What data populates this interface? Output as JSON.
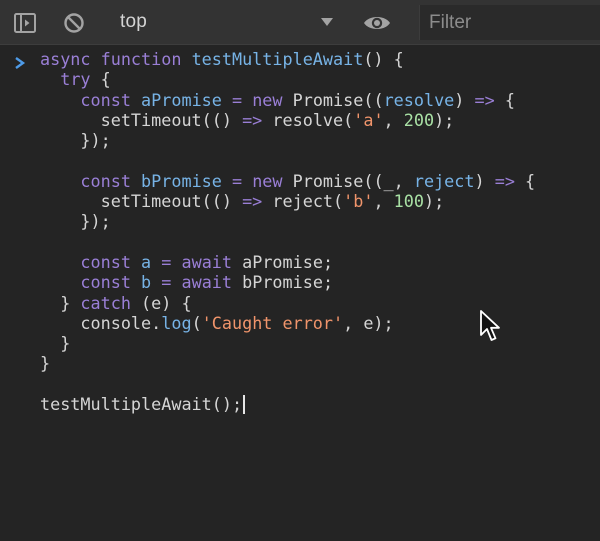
{
  "toolbar": {
    "sidebar_icon": "sidebar-toggle-icon",
    "clear_icon": "clear-console-icon",
    "context_value": "top",
    "caret_icon": "caret-down-icon",
    "eye_icon": "live-expression-eye-icon",
    "filter_placeholder": "Filter",
    "filter_value": ""
  },
  "console": {
    "prompt_icon": "prompt-chevron-icon",
    "lines": [
      [
        [
          "kw",
          "async "
        ],
        [
          "kw",
          "function "
        ],
        [
          "fn",
          "testMultipleAwait"
        ],
        [
          "pl",
          "() {"
        ]
      ],
      [
        [
          "pl",
          "  "
        ],
        [
          "kw",
          "try"
        ],
        [
          "pl",
          " {"
        ]
      ],
      [
        [
          "pl",
          "    "
        ],
        [
          "kw",
          "const "
        ],
        [
          "var",
          "aPromise"
        ],
        [
          "pl",
          " "
        ],
        [
          "kw",
          "="
        ],
        [
          "pl",
          " "
        ],
        [
          "kw",
          "new"
        ],
        [
          "pl",
          " Promise(("
        ],
        [
          "par",
          "resolve"
        ],
        [
          "pl",
          ") "
        ],
        [
          "kw",
          "=>"
        ],
        [
          "pl",
          " {"
        ]
      ],
      [
        [
          "pl",
          "      setTimeout(() "
        ],
        [
          "kw",
          "=>"
        ],
        [
          "pl",
          " resolve("
        ],
        [
          "str",
          "'a'"
        ],
        [
          "pl",
          ", "
        ],
        [
          "num",
          "200"
        ],
        [
          "pl",
          ");"
        ]
      ],
      [
        [
          "pl",
          "    });"
        ]
      ],
      [
        [
          "pl",
          ""
        ]
      ],
      [
        [
          "pl",
          "    "
        ],
        [
          "kw",
          "const "
        ],
        [
          "var",
          "bPromise"
        ],
        [
          "pl",
          " "
        ],
        [
          "kw",
          "="
        ],
        [
          "pl",
          " "
        ],
        [
          "kw",
          "new"
        ],
        [
          "pl",
          " Promise((_"
        ],
        [
          "pl",
          ", "
        ],
        [
          "par",
          "reject"
        ],
        [
          "pl",
          ") "
        ],
        [
          "kw",
          "=>"
        ],
        [
          "pl",
          " {"
        ]
      ],
      [
        [
          "pl",
          "      setTimeout(() "
        ],
        [
          "kw",
          "=>"
        ],
        [
          "pl",
          " reject("
        ],
        [
          "str",
          "'b'"
        ],
        [
          "pl",
          ", "
        ],
        [
          "num",
          "100"
        ],
        [
          "pl",
          ");"
        ]
      ],
      [
        [
          "pl",
          "    });"
        ]
      ],
      [
        [
          "pl",
          ""
        ]
      ],
      [
        [
          "pl",
          "    "
        ],
        [
          "kw",
          "const "
        ],
        [
          "var",
          "a"
        ],
        [
          "pl",
          " "
        ],
        [
          "kw",
          "="
        ],
        [
          "pl",
          " "
        ],
        [
          "kw",
          "await"
        ],
        [
          "pl",
          " aPromise;"
        ]
      ],
      [
        [
          "pl",
          "    "
        ],
        [
          "kw",
          "const "
        ],
        [
          "var",
          "b"
        ],
        [
          "pl",
          " "
        ],
        [
          "kw",
          "="
        ],
        [
          "pl",
          " "
        ],
        [
          "kw",
          "await"
        ],
        [
          "pl",
          " bPromise;"
        ]
      ],
      [
        [
          "pl",
          "  } "
        ],
        [
          "kw",
          "catch"
        ],
        [
          "pl",
          " (e) {"
        ]
      ],
      [
        [
          "pl",
          "    console."
        ],
        [
          "fn",
          "log"
        ],
        [
          "pl",
          "("
        ],
        [
          "str",
          "'Caught error'"
        ],
        [
          "pl",
          ", e);"
        ]
      ],
      [
        [
          "pl",
          "  }"
        ]
      ],
      [
        [
          "pl",
          "}"
        ]
      ],
      [
        [
          "pl",
          ""
        ]
      ],
      [
        [
          "pl",
          "testMultipleAwait();"
        ]
      ]
    ]
  },
  "colors": {
    "background": "#242424",
    "toolbar_background": "#333333",
    "keyword": "#9a7fd6",
    "function_name": "#77b3e6",
    "string": "#f0946b",
    "number": "#a8e0a4",
    "plain": "#d5d5d5",
    "prompt": "#4e9be8"
  },
  "cursor_icon": "mouse-pointer-icon"
}
